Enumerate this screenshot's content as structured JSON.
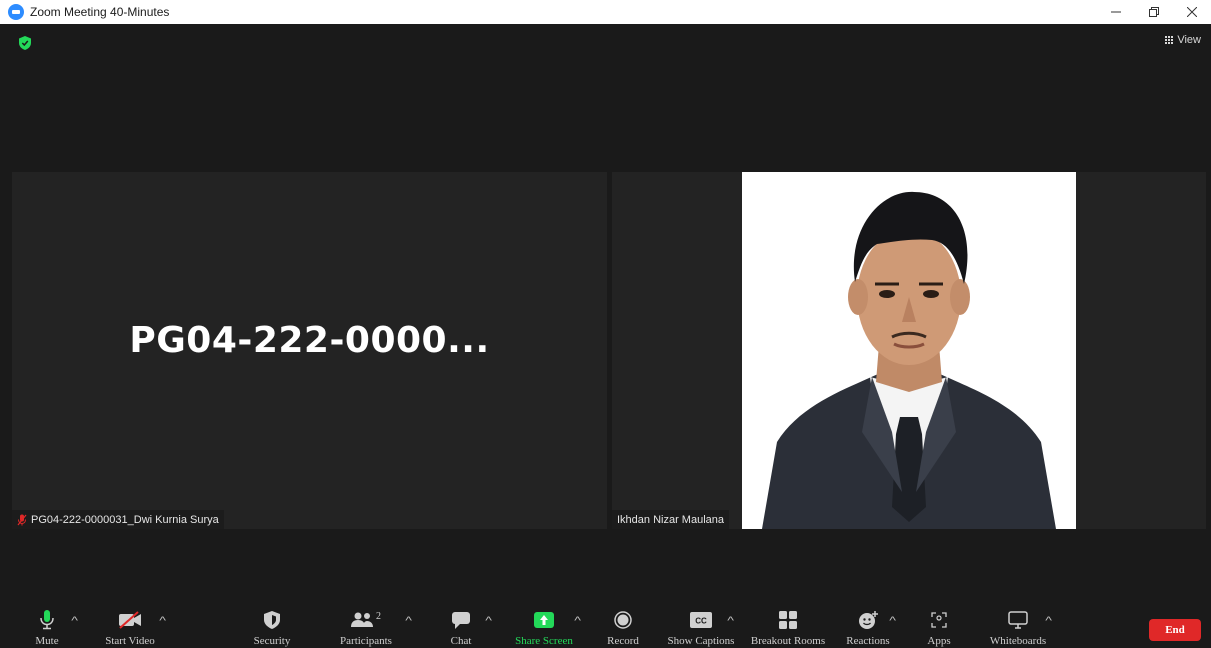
{
  "window": {
    "title": "Zoom Meeting 40-Minutes",
    "controls": [
      "minimize",
      "restore",
      "close"
    ]
  },
  "meeting": {
    "view_label": "View",
    "tiles": [
      {
        "display_name": "PG04-222-0000...",
        "name_tag": "PG04-222-0000031_Dwi Kurnia Surya",
        "mic": "muted"
      },
      {
        "name_tag": "Ikhdan Nizar Maulana",
        "video": "on"
      }
    ]
  },
  "toolbar": {
    "mute": "Mute",
    "start_video": "Start Video",
    "security": "Security",
    "participants": "Participants",
    "participants_count": "2",
    "chat": "Chat",
    "share_screen": "Share Screen",
    "record": "Record",
    "show_captions": "Show Captions",
    "breakout_rooms": "Breakout Rooms",
    "reactions": "Reactions",
    "apps": "Apps",
    "whiteboards": "Whiteboards",
    "end": "End"
  },
  "colors": {
    "background": "#1a1a1a",
    "tile": "#232323",
    "accent_green": "#23d959",
    "end_red": "#e02828",
    "zoom_blue": "#2d8cff"
  }
}
